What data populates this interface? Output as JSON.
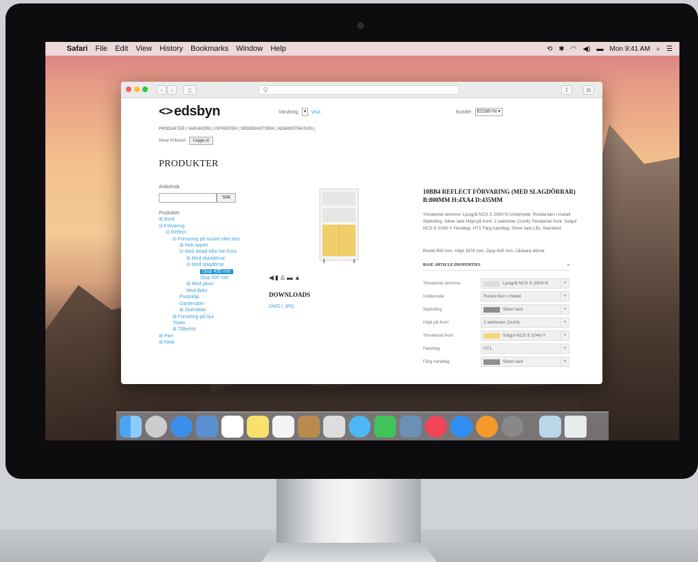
{
  "menubar": {
    "app": "Safari",
    "items": [
      "File",
      "Edit",
      "View",
      "History",
      "Bookmarks",
      "Window",
      "Help"
    ],
    "clock": "Mon 9:41 AM"
  },
  "browser": {
    "address_placeholder": "Q"
  },
  "site": {
    "logo": "edsbyn",
    "varukorg_label": "Varukorg:",
    "visa": "Visa",
    "kunder_label": "Kunder:",
    "kunder_value": "EDSBYN",
    "topnav": "PRODUKTER | VARUKORG | OFFERTER | ORDERHISTORIK | ADMINISTRATION |",
    "user": "Nisse Eriksson",
    "logout": "Logga ut",
    "heading": "PRODUKTER",
    "search_label": "Artikelsök",
    "search_button": "Sök"
  },
  "tree": [
    {
      "label": "Produkter",
      "plain": true
    },
    {
      "label": "⊞ Bord"
    },
    {
      "label": "⊟ Förvaring"
    },
    {
      "label": "⊟ Reflect"
    },
    {
      "label": "⊟ Förvaring på sockel eller ben"
    },
    {
      "label": "⊞ Helt öppen"
    },
    {
      "label": "⊟ Med delad eller hel front"
    },
    {
      "label": "⊞ Med skjutdörrar"
    },
    {
      "label": "⊟ Med slagdörrar"
    },
    {
      "label": "Djup 435 mm",
      "selected": true
    },
    {
      "label": "Djup 600 mm"
    },
    {
      "label": "⊞ Med jalusi"
    },
    {
      "label": "Med lådor"
    },
    {
      "label": "Postskåp"
    },
    {
      "label": "Garderober"
    },
    {
      "label": "⊞ Överdelar"
    },
    {
      "label": "⊞ Förvaring på hjul"
    },
    {
      "label": "Tower"
    },
    {
      "label": "⊞ Tillbehör"
    },
    {
      "label": "⊞ Part"
    },
    {
      "label": "⊞ Neat"
    }
  ],
  "product": {
    "downloads_title": "DOWNLOADS",
    "downloads_links": "DWG | JPG",
    "title": "10BB4 REFLECT FÖRVARING (MED SLAGDÖRRAR) B:800MM H:4XA4 D:435MM",
    "description": "Ytmaterial stomme: Ljusgrå NCS S 2500-N Underrede: Runda ben i metall Stativfärg: Silver lack Höjd på front: 2 sektioner (2xA4) Ytmaterial front: Solgul NCS S 1040-Y Handtag: HT1 Färg handtag: Silver lack Lås: Standard",
    "size": "Bredd 800 mm. Höjd 1676 mm. Djup 435 mm. Låsbara dörrar.",
    "base_title": "BASE ARTICLE PROPERTIES",
    "properties": [
      {
        "label": "Ytmaterial stomme",
        "value": "Ljusgrå NCS S 2500-N",
        "swatch": "#dcdcdc"
      },
      {
        "label": "Underrede",
        "value": "Runda ben i metall",
        "swatch": ""
      },
      {
        "label": "Stativfärg",
        "value": "Silver lack",
        "swatch": "#8e8e8e"
      },
      {
        "label": "Höjd på front",
        "value": "2 sektioner (2xA4)",
        "swatch": ""
      },
      {
        "label": "Ytmaterial front",
        "value": "Solgul NCS S 1040-Y",
        "swatch": "#f3d77a"
      },
      {
        "label": "Handtag",
        "value": "HT1",
        "swatch": ""
      },
      {
        "label": "Färg handtag",
        "value": "Silver lack",
        "swatch": "#8e8e8e"
      }
    ]
  },
  "colors": {
    "link": "#3fa0d8",
    "selected": "#1a8fd1",
    "cabinet_front": "#f0cf6a"
  }
}
